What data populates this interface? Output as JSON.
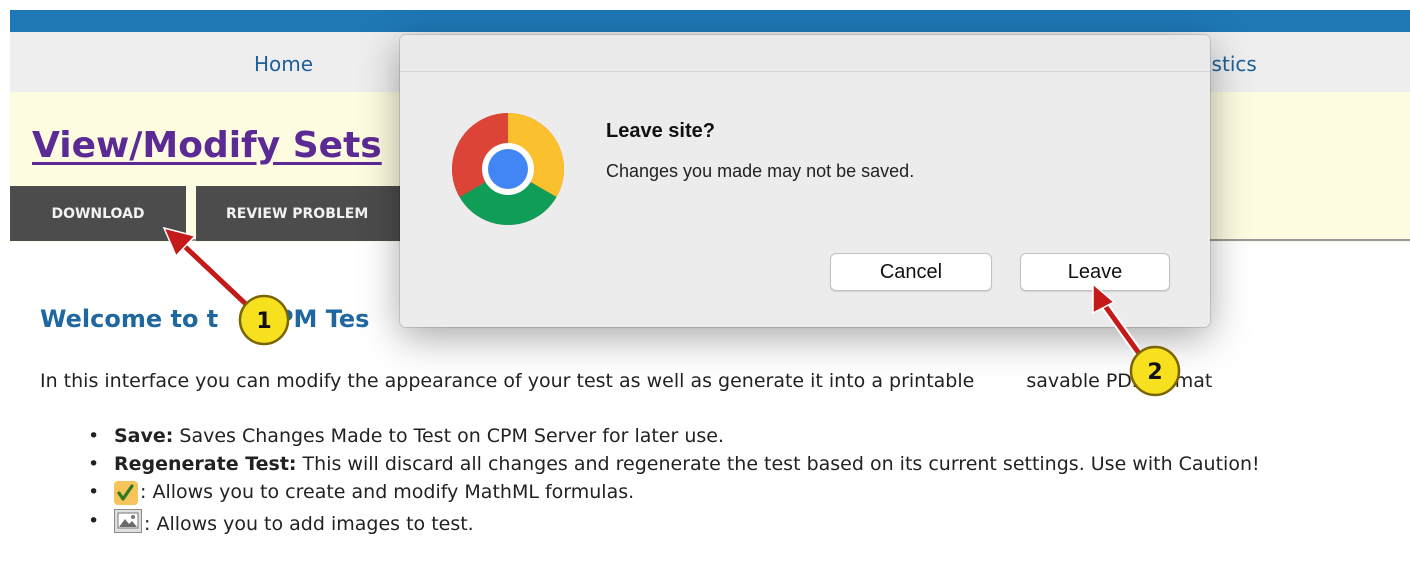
{
  "nav": {
    "home": "Home",
    "statistics_partial": "istics"
  },
  "page": {
    "title": "View/Modify Sets",
    "tabs": [
      "DOWNLOAD",
      "REVIEW PROBLEM"
    ]
  },
  "content": {
    "welcome_start": "Welcome to t",
    "welcome_end": "CPM Tes",
    "intro_start": "In this interface you can modify the appearance of your test as well as generate it into a printable",
    "intro_end": "savable PDF format",
    "features": [
      {
        "bold": "Save:",
        "text": " Saves Changes Made to Test on CPM Server for later use."
      },
      {
        "bold": "Regenerate Test:",
        "text": " This will discard all changes and regenerate the test based on its current settings. Use with Caution!"
      },
      {
        "icon": "mathml-icon",
        "text": ": Allows you to create and modify MathML formulas."
      },
      {
        "icon": "image-icon",
        "text": ": Allows you to add images to test."
      }
    ]
  },
  "dialog": {
    "title": "Leave site?",
    "message": "Changes you made may not be saved.",
    "cancel_label": "Cancel",
    "leave_label": "Leave"
  },
  "callouts": {
    "step1": "1",
    "step2": "2"
  },
  "colors": {
    "topbar": "#1e78b6",
    "title": "#5b2a94",
    "heading": "#1f67a0",
    "tab_bg": "#4c4c4c",
    "callout_fill": "#f7e11f",
    "arrow": "#c41a1a"
  }
}
